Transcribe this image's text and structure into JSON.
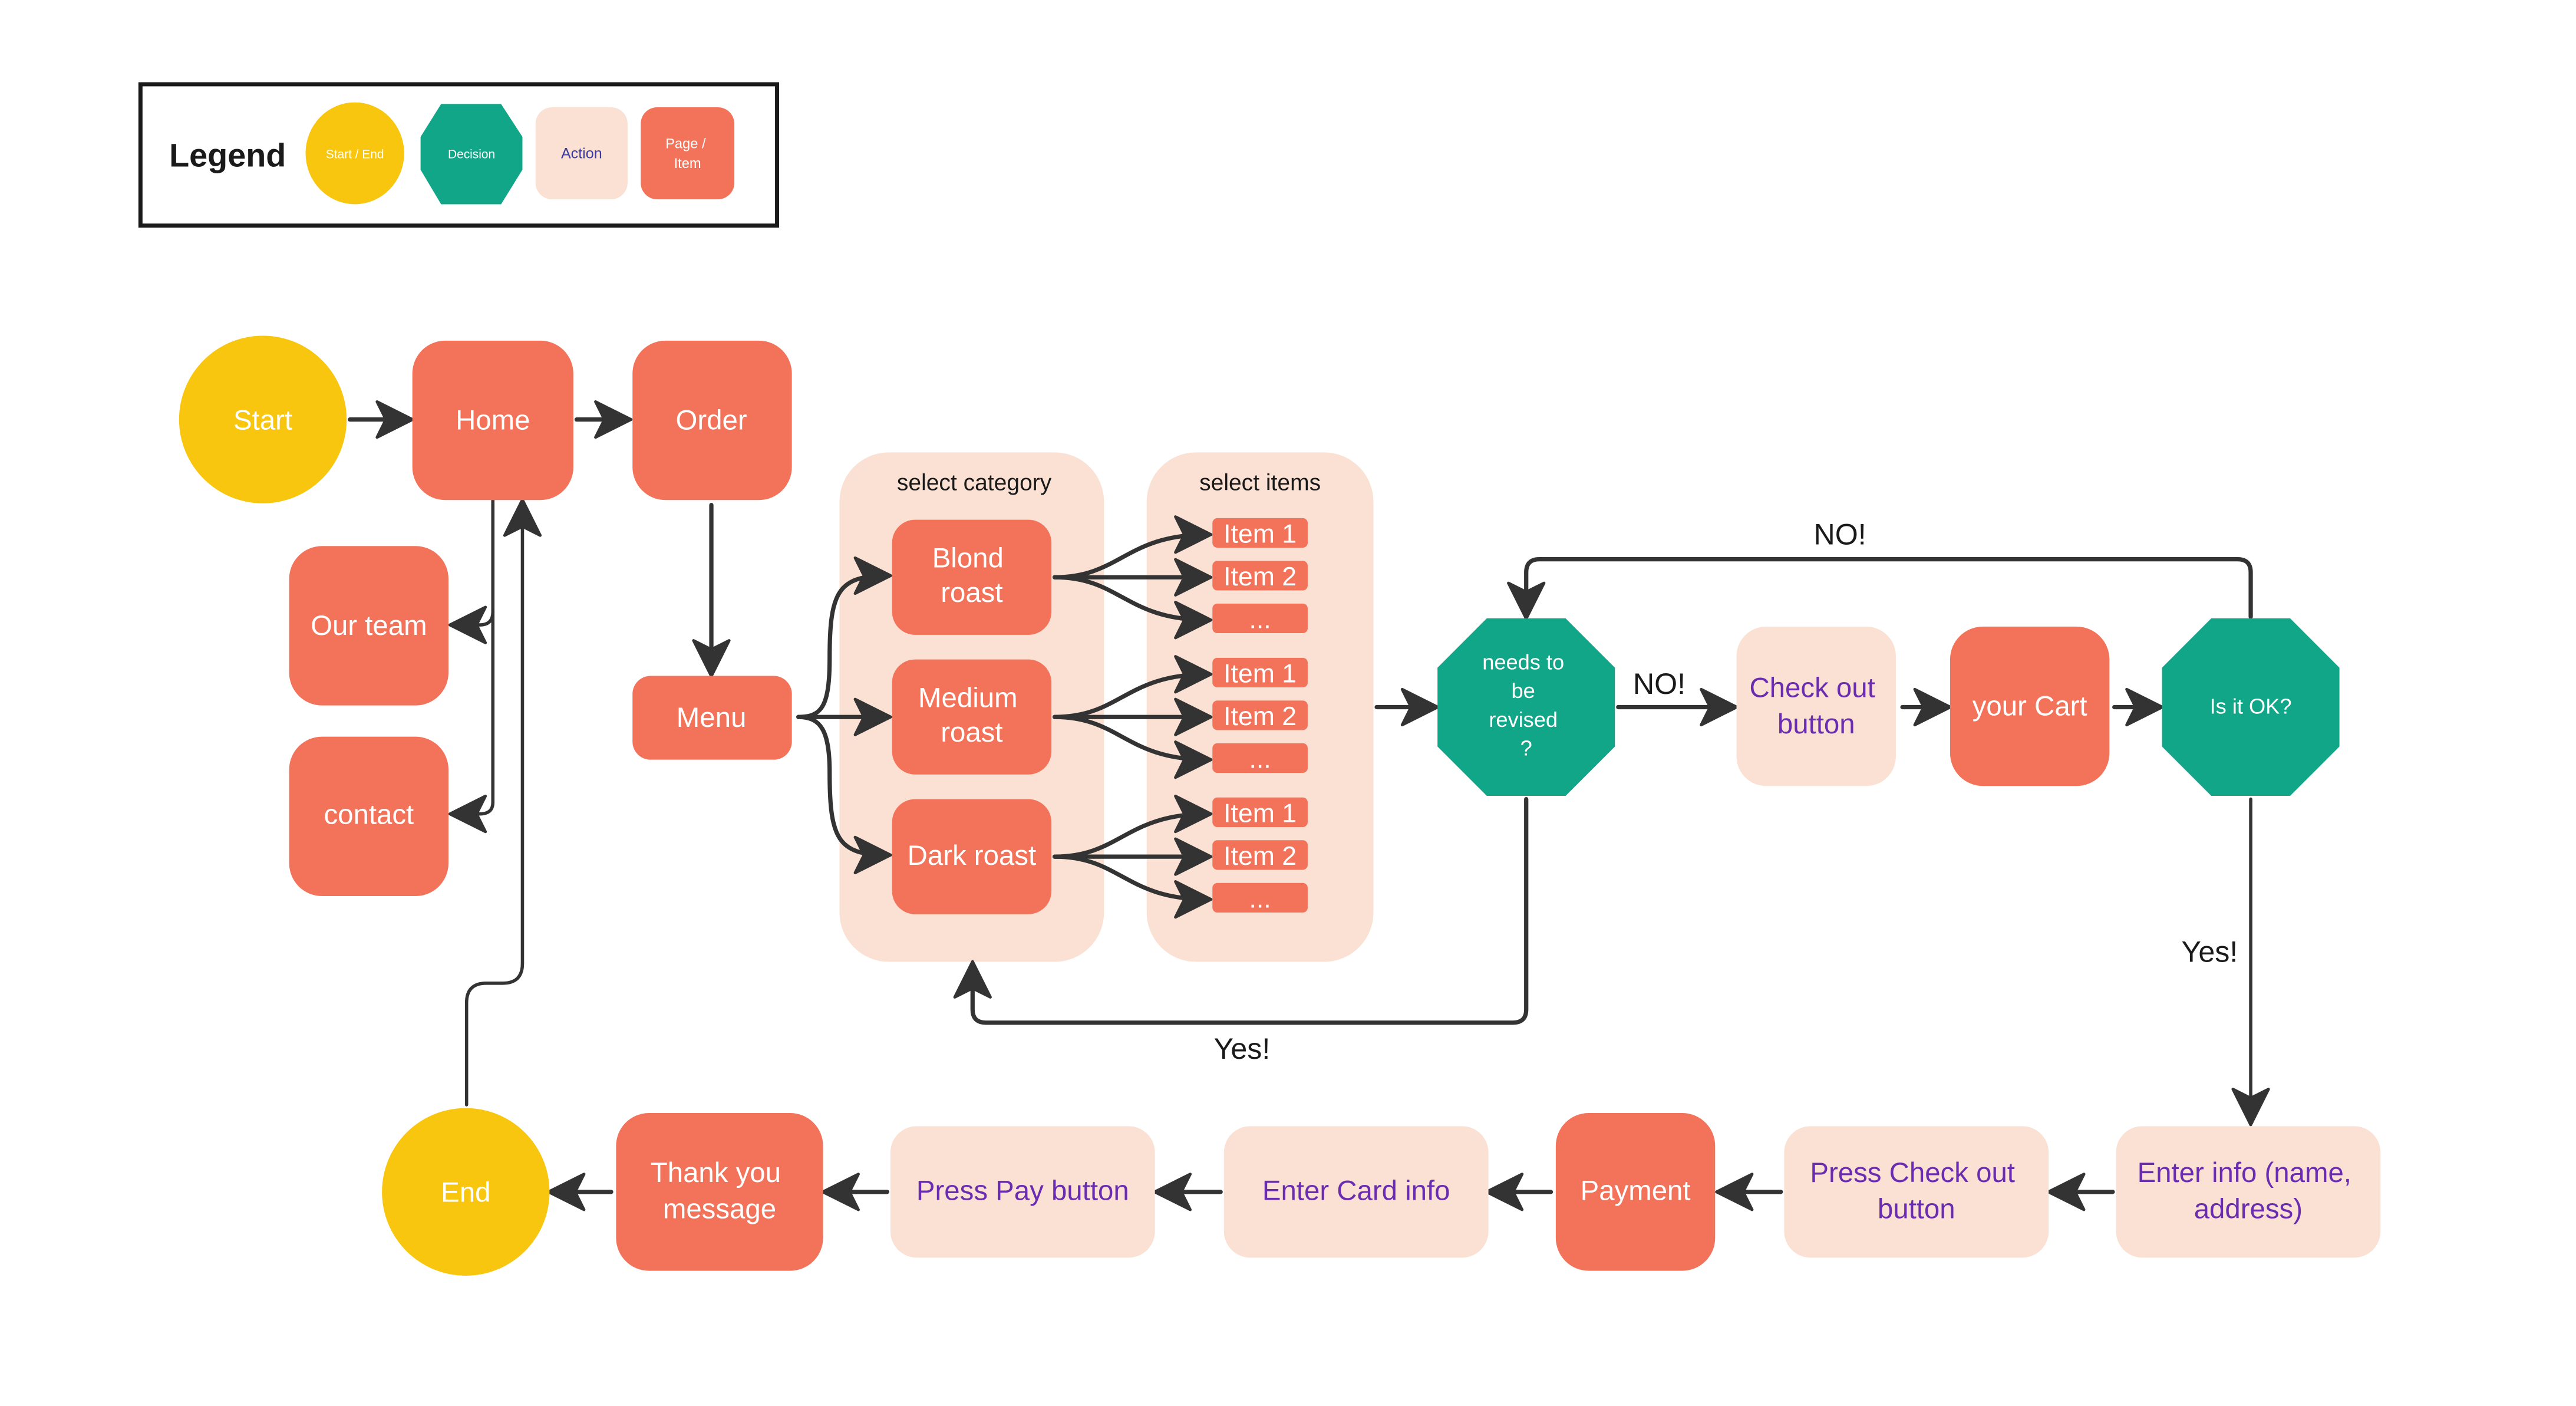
{
  "colors": {
    "start_end": "#F8C60F",
    "decision": "#12A689",
    "action_fill": "#FAE1D3",
    "action_text": "#6A2CB0",
    "page_item": "#F3735A",
    "line": "#333333",
    "legend_border": "#1A1A1A",
    "white_text": "#FFFFFF",
    "dark_text": "#1A1A1A"
  },
  "legend": {
    "title": "Legend",
    "items": [
      {
        "type": "start_end",
        "label": "Start / End"
      },
      {
        "type": "decision",
        "label": "Decision"
      },
      {
        "type": "action",
        "label": "Action"
      },
      {
        "type": "page_item",
        "label_lines": [
          "Page /",
          "Item"
        ]
      }
    ]
  },
  "nodes": {
    "start": {
      "type": "start_end",
      "label": "Start"
    },
    "home": {
      "type": "page_item",
      "label": "Home"
    },
    "order": {
      "type": "page_item",
      "label": "Order"
    },
    "our_team": {
      "type": "page_item",
      "label": "Our team"
    },
    "contact": {
      "type": "page_item",
      "label": "contact"
    },
    "menu": {
      "type": "page_item",
      "label": "Menu"
    },
    "blond": {
      "type": "page_item",
      "label_lines": [
        "Blond",
        "roast"
      ]
    },
    "medium": {
      "type": "page_item",
      "label_lines": [
        "Medium",
        "roast"
      ]
    },
    "dark": {
      "type": "page_item",
      "label": "Dark roast"
    },
    "revise": {
      "type": "decision",
      "label_lines": [
        "needs to",
        "be",
        "revised",
        "?"
      ]
    },
    "checkout_btn": {
      "type": "action",
      "label_lines": [
        "Check out",
        "button"
      ]
    },
    "cart": {
      "type": "page_item",
      "label": "your Cart"
    },
    "is_ok": {
      "type": "decision",
      "label": "Is it OK?"
    },
    "enter_info": {
      "type": "action",
      "label_lines": [
        "Enter info (name,",
        "address)"
      ]
    },
    "press_checkout": {
      "type": "action",
      "label_lines": [
        "Press Check out",
        "button"
      ]
    },
    "payment": {
      "type": "page_item",
      "label": "Payment"
    },
    "card_info": {
      "type": "action",
      "label": "Enter Card info"
    },
    "press_pay": {
      "type": "action",
      "label": "Press Pay button"
    },
    "thank_you": {
      "type": "page_item",
      "label_lines": [
        "Thank you",
        "message"
      ]
    },
    "end": {
      "type": "start_end",
      "label": "End"
    }
  },
  "groups": {
    "category": {
      "label": "select category"
    },
    "items": {
      "label": "select items"
    }
  },
  "item_groups": [
    {
      "category": "Blond roast",
      "items": [
        "Item 1",
        "Item 2",
        "..."
      ]
    },
    {
      "category": "Medium roast",
      "items": [
        "Item 1",
        "Item 2",
        "..."
      ]
    },
    {
      "category": "Dark roast",
      "items": [
        "Item 1",
        "Item 2",
        "..."
      ]
    }
  ],
  "edge_labels": {
    "no_top": "NO!",
    "no_mid": "NO!",
    "yes_bottom": "Yes!",
    "yes_right": "Yes!"
  },
  "edges": [
    {
      "from": "start",
      "to": "home"
    },
    {
      "from": "home",
      "to": "order"
    },
    {
      "from": "home",
      "to": "our_team"
    },
    {
      "from": "home",
      "to": "contact"
    },
    {
      "from": "order",
      "to": "menu"
    },
    {
      "from": "menu",
      "to": "blond"
    },
    {
      "from": "menu",
      "to": "medium"
    },
    {
      "from": "menu",
      "to": "dark"
    },
    {
      "from": "items",
      "to": "revise"
    },
    {
      "from": "revise",
      "to": "checkout_btn",
      "label": "NO!"
    },
    {
      "from": "revise",
      "to": "category",
      "label": "Yes!"
    },
    {
      "from": "checkout_btn",
      "to": "cart"
    },
    {
      "from": "cart",
      "to": "is_ok"
    },
    {
      "from": "is_ok",
      "to": "revise",
      "label": "NO!"
    },
    {
      "from": "is_ok",
      "to": "enter_info",
      "label": "Yes!"
    },
    {
      "from": "enter_info",
      "to": "press_checkout"
    },
    {
      "from": "press_checkout",
      "to": "payment"
    },
    {
      "from": "payment",
      "to": "card_info"
    },
    {
      "from": "card_info",
      "to": "press_pay"
    },
    {
      "from": "press_pay",
      "to": "thank_you"
    },
    {
      "from": "thank_you",
      "to": "end"
    },
    {
      "from": "end",
      "to": "home"
    }
  ]
}
